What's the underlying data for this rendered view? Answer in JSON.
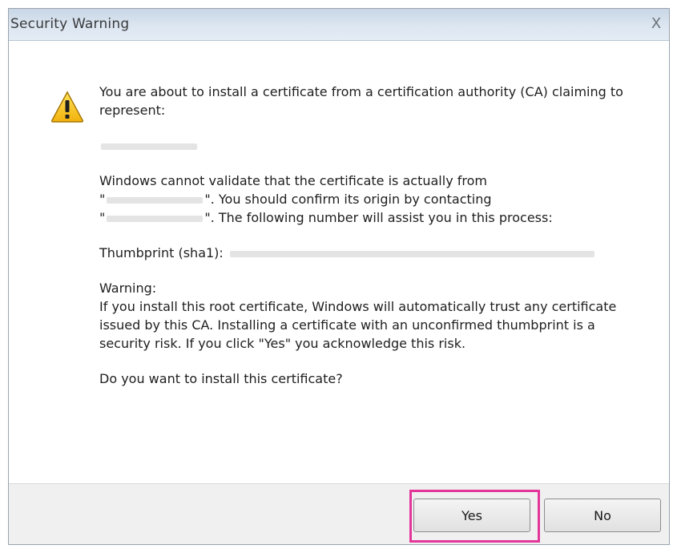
{
  "window": {
    "title": "Security Warning",
    "close_glyph": "X"
  },
  "icons": {
    "warning": "warning-triangle-icon",
    "close": "close-icon"
  },
  "message": {
    "intro": "You are about to install a certificate from a certification authority (CA) claiming to represent:",
    "validate_part1": "Windows cannot validate that the certificate is actually from",
    "validate_part2": "\". You should confirm its origin by contacting",
    "validate_part3": "\". The following number will assist you in this process:",
    "quote_open": "\"",
    "thumbprint_label": "Thumbprint (sha1):",
    "warning_title": "Warning:",
    "warning_body": "If you install this root certificate, Windows will automatically trust any certificate issued by this CA. Installing a certificate with an unconfirmed thumbprint is a security risk. If you click \"Yes\" you acknowledge this risk.",
    "question": "Do you want to install this certificate?"
  },
  "buttons": {
    "yes": "Yes",
    "no": "No"
  },
  "colors": {
    "highlight": "#e3369b",
    "titlebar": "#d4e0ec",
    "footer": "#f0f0f0"
  }
}
